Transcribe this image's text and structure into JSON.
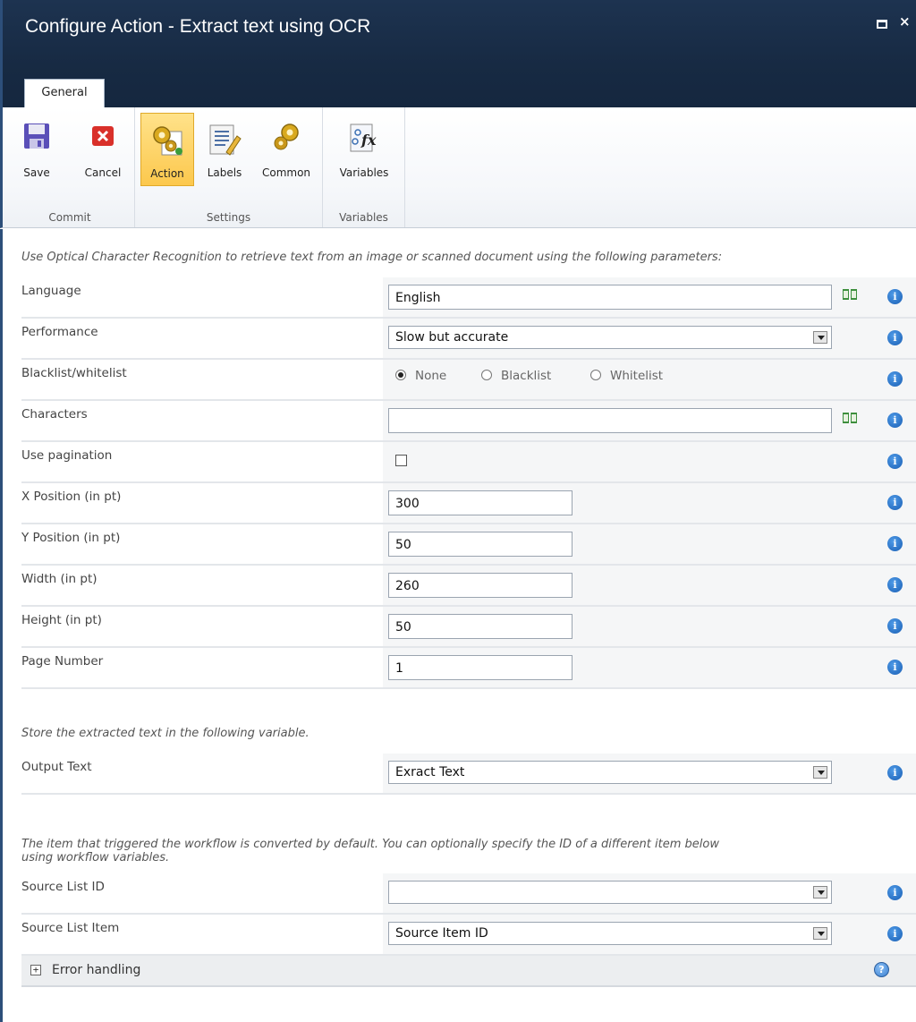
{
  "window": {
    "title": "Configure Action - Extract text using OCR",
    "maximize_glyph": "",
    "close_glyph": "×"
  },
  "tabs": [
    {
      "label": "General"
    }
  ],
  "ribbon": {
    "groups": [
      {
        "label": "Commit"
      },
      {
        "label": "Settings"
      },
      {
        "label": "Variables"
      }
    ],
    "buttons": {
      "save": "Save",
      "cancel": "Cancel",
      "action": "Action",
      "labels": "Labels",
      "common": "Common",
      "variables": "Variables"
    }
  },
  "form": {
    "intro": "Use Optical Character Recognition to retrieve text from an image or scanned document using the following parameters:",
    "language": {
      "label": "Language",
      "value": "English"
    },
    "performance": {
      "label": "Performance",
      "value": "Slow but accurate"
    },
    "blacklist": {
      "label": "Blacklist/whitelist",
      "options": [
        "None",
        "Blacklist",
        "Whitelist"
      ],
      "selected": "None"
    },
    "characters": {
      "label": "Characters",
      "value": ""
    },
    "pagination": {
      "label": "Use pagination",
      "checked": false
    },
    "x_position": {
      "label": "X Position (in pt)",
      "value": "300"
    },
    "y_position": {
      "label": "Y Position (in pt)",
      "value": "50"
    },
    "width": {
      "label": "Width (in pt)",
      "value": "260"
    },
    "height": {
      "label": "Height (in pt)",
      "value": "50"
    },
    "page_number": {
      "label": "Page Number",
      "value": "1"
    },
    "store_intro": "Store the extracted text in the following variable.",
    "output_text": {
      "label": "Output Text",
      "value": "Exract Text"
    },
    "item_intro_1": "The item that triggered the workflow is converted by default. You can optionally specify the ID of a different item below",
    "item_intro_2": "using workflow variables.",
    "source_list_id": {
      "label": "Source List ID",
      "value": ""
    },
    "source_list_item": {
      "label": "Source List Item",
      "value": "Source Item ID"
    },
    "error_handling": {
      "label": "Error handling",
      "expander": "+"
    },
    "info_glyph": "i",
    "help_glyph": "?"
  },
  "colors": {
    "title_bar": "#1d3350",
    "ribbon_active": "#fcc84d",
    "info_icon": "#1a5fb4"
  }
}
